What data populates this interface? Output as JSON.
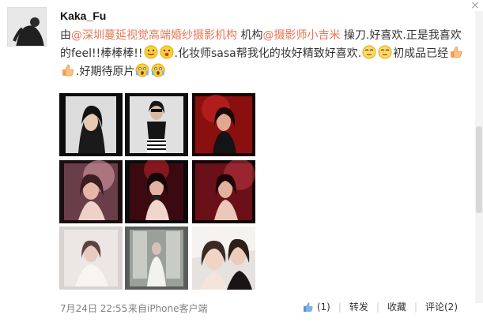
{
  "post": {
    "username": "Kaka_Fu",
    "text": {
      "part1": "由",
      "mention1": "@深圳蔓延视觉高端婚纱摄影机构",
      "part2": " 机构",
      "mention2": "@摄影师小吉米",
      "part3": " 操刀.好喜欢.正是我喜欢的feel!!棒棒棒!!",
      "part4": ".化妆师sasa帮我化的妆好精致好喜欢.",
      "part5": "初成品已经",
      "part6": ".好期待原片"
    },
    "emojis": [
      "smile-emoji",
      "happy-emoji",
      "shy-emoji",
      "thumbs-up-emoji",
      "shocked-emoji"
    ],
    "images": [
      {
        "name": "photo-1"
      },
      {
        "name": "photo-2"
      },
      {
        "name": "photo-3"
      },
      {
        "name": "photo-4"
      },
      {
        "name": "photo-5"
      },
      {
        "name": "photo-6"
      },
      {
        "name": "photo-7"
      },
      {
        "name": "photo-8"
      },
      {
        "name": "photo-9"
      }
    ],
    "time": "7月24日 22:55",
    "source": "来自iPhone客户端"
  },
  "actions": {
    "like_count": "(1)",
    "forward_label": "转发",
    "favorite_label": "收藏",
    "comment_label": "评论(2)"
  },
  "colors": {
    "link": "#eb7350",
    "meta": "#808080"
  }
}
